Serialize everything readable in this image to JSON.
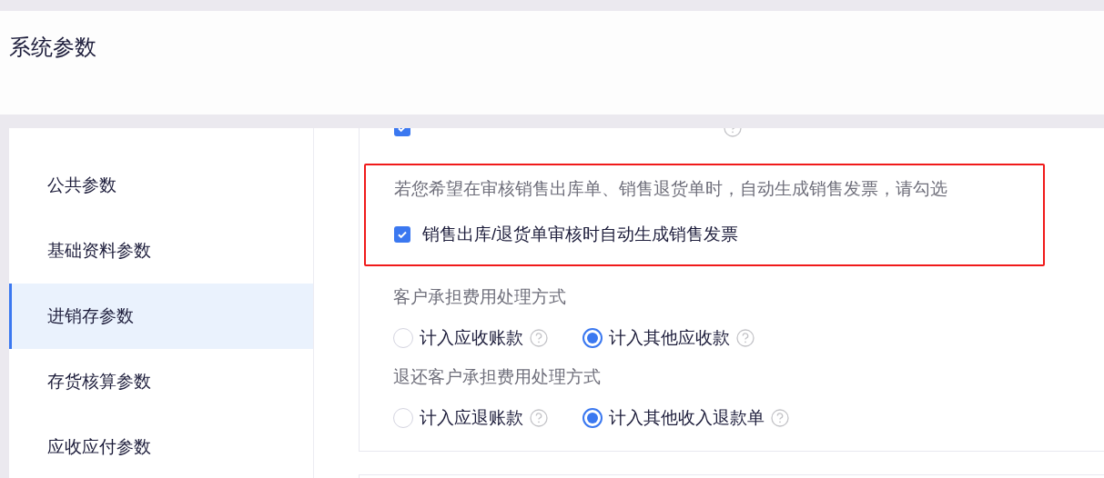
{
  "page_title": "系统参数",
  "sidebar": {
    "items": [
      {
        "label": "公共参数",
        "selected": false
      },
      {
        "label": "基础资料参数",
        "selected": false
      },
      {
        "label": "进销存参数",
        "selected": true
      },
      {
        "label": "存货核算参数",
        "selected": false
      },
      {
        "label": "应收应付参数",
        "selected": false
      }
    ]
  },
  "settings": {
    "cut_row": {
      "checked": true
    },
    "highlight_box": {
      "hint": "若您希望在审核销售出库单、销售退货单时，自动生成销售发票，请勾选",
      "option": {
        "label": "销售出库/退货单审核时自动生成销售发票",
        "checked": true
      }
    },
    "groups": [
      {
        "title": "客户承担费用处理方式",
        "options": [
          {
            "label": "计入应收账款",
            "selected": false
          },
          {
            "label": "计入其他应收款",
            "selected": true
          }
        ]
      },
      {
        "title": "退还客户承担费用处理方式",
        "options": [
          {
            "label": "计入应退账款",
            "selected": false
          },
          {
            "label": "计入其他收入退款单",
            "selected": true
          }
        ]
      }
    ]
  }
}
